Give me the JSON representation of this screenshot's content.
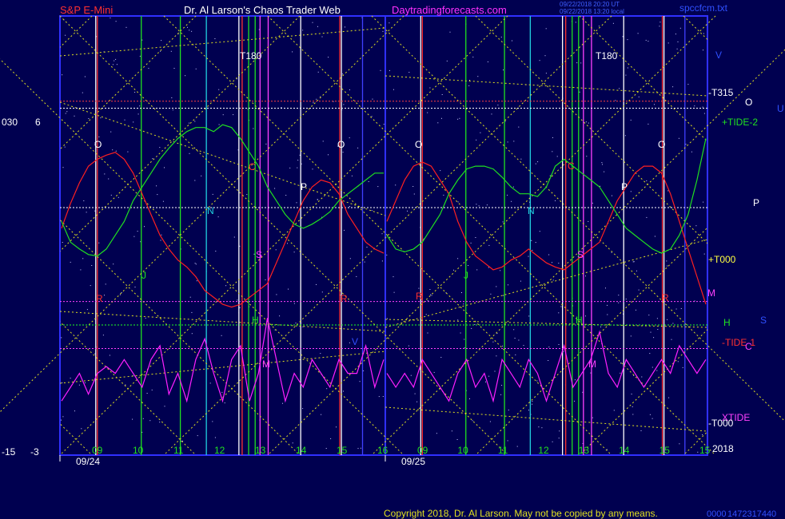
{
  "header": {
    "symbol": "S&P E-Mini",
    "site": "Dr. Al Larson's Chaos Trader Web",
    "url": "Daytradingforecasts.com",
    "timestamp1": "09/22/2018 20:20 UT",
    "timestamp2": "09/22/2018 13:20 local",
    "file": "spccfcm.txt"
  },
  "footer": {
    "copyright": "Copyright 2018, Dr. Al Larson. May not be copied by any means.",
    "code1": "0000",
    "code2": "1472317440"
  },
  "colors": {
    "background": "#000050",
    "frame": "#3030ff",
    "red_line": "#ff2020",
    "green_line": "#20e020",
    "magenta_line": "#ff20ff",
    "yellow": "#e0e020",
    "white": "#ffffff",
    "cyan": "#20d0e0"
  },
  "chart_data": {
    "type": "line",
    "left_axis": [
      "030",
      "6",
      "-15",
      "-3"
    ],
    "panels": [
      {
        "date": "09/24",
        "hours": [
          "09",
          "10",
          "11",
          "12",
          "13",
          "14",
          "15",
          "16"
        ],
        "series": [
          {
            "color": "red",
            "values": [
              -1.5,
              0.3,
              1.8,
              3.0,
              3.5,
              3.8,
              4.0,
              3.5,
              2.5,
              1.0,
              -0.5,
              -2.0,
              -3.0,
              -3.8,
              -4.3,
              -5.0,
              -6.0,
              -6.5,
              -7.0,
              -7.2,
              -7.0,
              -6.5,
              -6.0,
              -5.5,
              -4.0,
              -2.5,
              -1.0,
              0.5,
              1.5,
              2.0,
              1.8,
              1.0,
              -0.5,
              -1.5,
              -2.5,
              -3.0,
              -3.3
            ]
          },
          {
            "color": "green",
            "values": [
              -1.0,
              -2.5,
              -3.0,
              -3.4,
              -3.5,
              -3.0,
              -2.0,
              -1.0,
              0.5,
              1.5,
              2.5,
              3.5,
              4.3,
              5.0,
              5.5,
              5.8,
              5.8,
              5.5,
              6.0,
              5.8,
              5.0,
              4.0,
              3.0,
              1.5,
              0.5,
              -0.5,
              -1.2,
              -1.5,
              -1.2,
              -0.8,
              -0.3,
              0.5,
              1.0,
              1.5,
              2.0,
              2.5,
              2.5
            ]
          },
          {
            "color": "magenta",
            "values": [
              -14,
              -13,
              -12,
              -13.5,
              -12,
              -11.5,
              -12,
              -11,
              -12,
              -13,
              -11,
              -10,
              -13.5,
              -12,
              -14,
              -11,
              -9.5,
              -12,
              -14,
              -11,
              -10,
              -14,
              -12,
              -8,
              -11,
              -14,
              -12,
              -13,
              -11,
              -12,
              -13,
              -11,
              -12,
              -12,
              -10,
              -13,
              -11
            ]
          }
        ]
      },
      {
        "date": "09/25",
        "hours": [
          "09",
          "10",
          "11",
          "12",
          "13",
          "14",
          "15",
          "15"
        ],
        "series": [
          {
            "color": "red",
            "values": [
              -1.0,
              0.5,
              2.0,
              3.0,
              3.3,
              3.0,
              2.0,
              1.0,
              -1.0,
              -2.5,
              -3.5,
              -4.0,
              -4.5,
              -4.3,
              -3.8,
              -3.5,
              -3.0,
              -3.5,
              -4.0,
              -4.3,
              -4.5,
              -4.0,
              -3.5,
              -3.0,
              -2.5,
              -1.0,
              0.5,
              1.5,
              2.5,
              3.0,
              3.0,
              2.5,
              1.0,
              -1.0,
              -3.0,
              -5.0,
              -7.0
            ]
          },
          {
            "color": "green",
            "values": [
              -2.0,
              -3.0,
              -3.2,
              -3.0,
              -2.5,
              -1.5,
              -0.5,
              1.0,
              2.0,
              2.8,
              3.0,
              3.0,
              2.8,
              2.2,
              1.5,
              1.0,
              1.0,
              0.8,
              1.5,
              3.0,
              3.5,
              3.0,
              2.5,
              2.0,
              1.5,
              0.5,
              -0.5,
              -1.5,
              -2.0,
              -2.5,
              -3.0,
              -3.3,
              -3.0,
              -2.0,
              -0.5,
              2.0,
              5.0
            ]
          },
          {
            "color": "magenta",
            "values": [
              -12,
              -13,
              -12,
              -13,
              -11,
              -12,
              -13,
              -14,
              -12,
              -11,
              -13,
              -12,
              -14,
              -11,
              -12,
              -13,
              -11,
              -12,
              -14,
              -12,
              -10,
              -13,
              -12,
              -11,
              -9,
              -12,
              -13,
              -11,
              -12,
              -13,
              -12,
              -11,
              -12,
              -10,
              -11,
              -12,
              -11
            ]
          }
        ]
      }
    ],
    "line_labels": [
      "T180",
      "T180",
      "-T315",
      "+TIDE-2",
      "+T000",
      "M",
      "H",
      "-TIDE-1",
      "XTIDE",
      "-T000",
      "2018",
      "V",
      "O",
      "U",
      "P",
      "S",
      "C"
    ],
    "planet_labels": [
      "O",
      "O",
      "O",
      "O",
      "P",
      "P",
      "R",
      "R",
      "R",
      "R",
      "N",
      "N",
      "J",
      "J",
      "S",
      "S",
      "C",
      "C",
      "H",
      "H",
      "M",
      "M",
      "V"
    ]
  }
}
